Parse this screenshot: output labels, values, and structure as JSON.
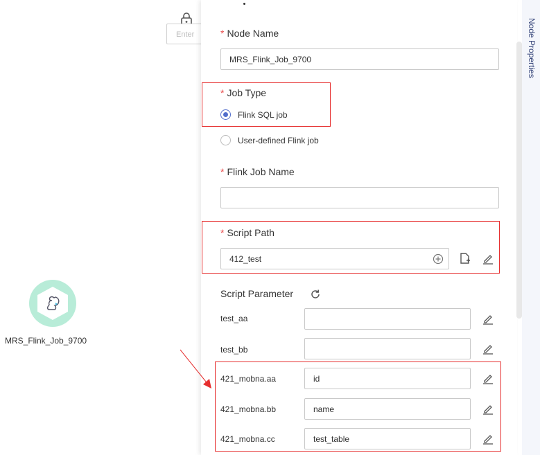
{
  "canvas": {
    "node_label": "MRS_Flink_Job_9700",
    "entry_hint": "Enter"
  },
  "panel": {
    "side_tab": "Node Properties",
    "node_name": {
      "label": "Node Name",
      "value": "MRS_Flink_Job_9700"
    },
    "job_type": {
      "label": "Job Type",
      "options": [
        "Flink SQL job",
        "User-defined Flink job"
      ],
      "selected": "Flink SQL job"
    },
    "flink_job_name": {
      "label": "Flink Job Name",
      "value": ""
    },
    "script_path": {
      "label": "Script Path",
      "value": "412_test"
    },
    "script_parameter": {
      "label": "Script Parameter",
      "rows": [
        {
          "key": "test_aa",
          "value": ""
        },
        {
          "key": "test_bb",
          "value": ""
        },
        {
          "key": "421_mobna.aa",
          "value": "id"
        },
        {
          "key": "421_mobna.bb",
          "value": "name"
        },
        {
          "key": "421_mobna.cc",
          "value": "test_table"
        }
      ]
    }
  },
  "colors": {
    "accent": "#526ecc",
    "highlight": "#e62e2e",
    "node_bg": "#b8ecd8",
    "required": "#e94e4e"
  }
}
